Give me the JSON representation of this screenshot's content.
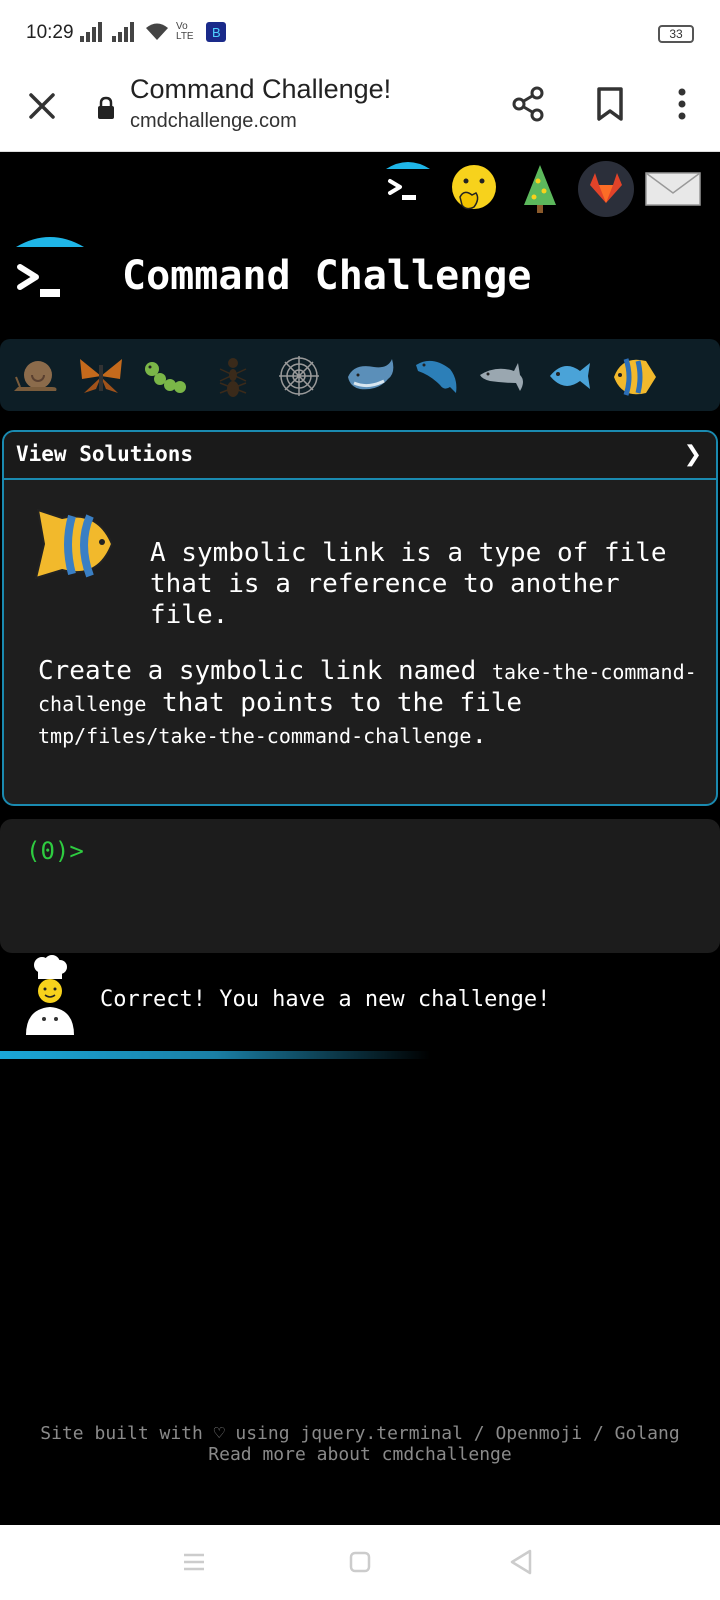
{
  "status_bar": {
    "time": "10:29",
    "battery": "33",
    "network_label": "Vo LTE"
  },
  "browser": {
    "title": "Command Challenge!",
    "url": "cmdchallenge.com"
  },
  "site": {
    "title": "Command Challenge"
  },
  "top_icons": [
    "terminal-icon",
    "hand-over-mouth-emoji-icon",
    "christmas-tree-icon",
    "gitlab-icon",
    "envelope-icon"
  ],
  "levels": [
    "snail-icon",
    "butterfly-icon",
    "caterpillar-icon",
    "ant-icon",
    "spider-web-icon",
    "whale-icon",
    "dolphin-icon",
    "dolphin-icon",
    "fish-icon",
    "tropical-fish-icon"
  ],
  "panel": {
    "header": "View Solutions",
    "chevron": "❯",
    "intro": "A symbolic link is a type of file that is a reference to another file.",
    "task_prefix": "Create a symbolic link named ",
    "task_code1": "take-the-command-challenge",
    "task_middle": " that points to the file ",
    "task_code2": "tmp/files/take-the-command-challenge",
    "task_suffix": "."
  },
  "terminal": {
    "prompt_open": "(",
    "prompt_count": "0",
    "prompt_close": ")>"
  },
  "message": "Correct! You have a new challenge!",
  "footer": {
    "line1": "Site built with ♡ using jquery.terminal / Openmoji / Golang",
    "line2": "Read more about cmdchallenge"
  },
  "colors": {
    "accent": "#1a8ab0",
    "prompt": "#2ecc40",
    "panel_bg": "#1e1e1e"
  }
}
